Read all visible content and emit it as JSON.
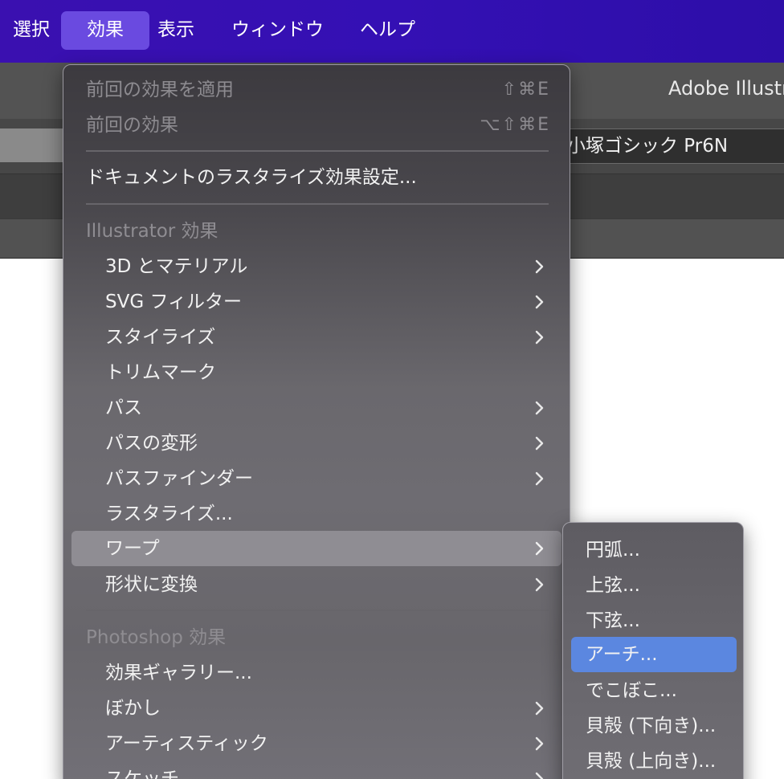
{
  "menubar": {
    "items": [
      {
        "label": "選択"
      },
      {
        "label": "効果"
      },
      {
        "label": "表示"
      },
      {
        "label": "ウィンドウ"
      },
      {
        "label": "ヘルプ"
      }
    ],
    "accent": "#3a10b0",
    "active_color": "#6a4ae0"
  },
  "app": {
    "title": "Adobe Illustr",
    "font_field": "小塚ゴシック Pr6N"
  },
  "menu": {
    "apply_last": {
      "label": "前回の効果を適用",
      "shortcut": "⇧⌘E"
    },
    "last_effect": {
      "label": "前回の効果",
      "shortcut": "⌥⇧⌘E"
    },
    "raster_settings": {
      "label": "ドキュメントのラスタライズ効果設定..."
    },
    "illustrator_header": "Illustrator 効果",
    "illustrator_items": [
      {
        "label": "3D とマテリアル",
        "submenu": true
      },
      {
        "label": "SVG フィルター",
        "submenu": true
      },
      {
        "label": "スタイライズ",
        "submenu": true
      },
      {
        "label": "トリムマーク",
        "submenu": false
      },
      {
        "label": "パス",
        "submenu": true
      },
      {
        "label": "パスの変形",
        "submenu": true
      },
      {
        "label": "パスファインダー",
        "submenu": true
      },
      {
        "label": "ラスタライズ...",
        "submenu": false
      },
      {
        "label": "ワープ",
        "submenu": true,
        "highlighted": true
      },
      {
        "label": "形状に変換",
        "submenu": true
      }
    ],
    "photoshop_header": "Photoshop 効果",
    "photoshop_items": [
      {
        "label": "効果ギャラリー...",
        "submenu": false
      },
      {
        "label": "ぼかし",
        "submenu": true
      },
      {
        "label": "アーティスティック",
        "submenu": true
      },
      {
        "label": "スケッチ",
        "submenu": true
      }
    ]
  },
  "warp_submenu": {
    "items": [
      {
        "label": "円弧..."
      },
      {
        "label": "上弦..."
      },
      {
        "label": "下弦..."
      },
      {
        "label": "アーチ...",
        "selected": true
      },
      {
        "label": "でこぼこ..."
      },
      {
        "label": "貝殻 (下向き)..."
      },
      {
        "label": "貝殻 (上向き)..."
      }
    ],
    "selected_color": "#5b87e0"
  }
}
